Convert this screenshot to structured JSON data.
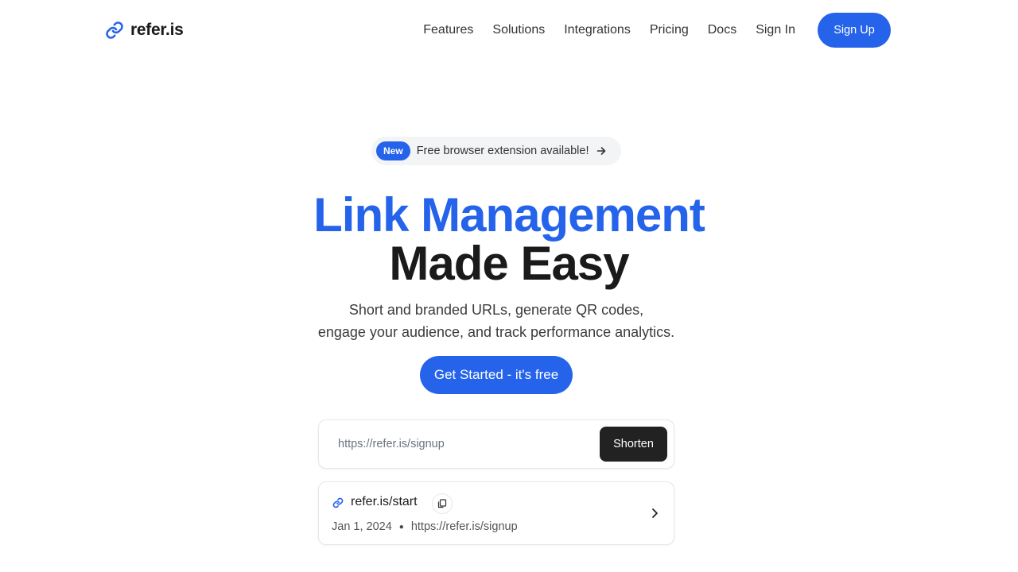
{
  "brand": {
    "name": "refer.is",
    "accent": "#2563eb"
  },
  "nav": {
    "items": [
      "Features",
      "Solutions",
      "Integrations",
      "Pricing",
      "Docs",
      "Sign In"
    ],
    "signup_label": "Sign Up"
  },
  "announcement": {
    "badge": "New",
    "text": "Free browser extension available!"
  },
  "hero": {
    "title_line1": "Link Management",
    "title_line2": "Made Easy",
    "subtitle_line1": "Short and branded URLs, generate QR codes,",
    "subtitle_line2": "engage your audience, and track performance analytics.",
    "cta_label": "Get Started - it's free"
  },
  "shortener": {
    "placeholder": "https://refer.is/signup",
    "button_label": "Shorten"
  },
  "link_card": {
    "short_url": "refer.is/start",
    "date": "Jan 1, 2024",
    "original_url": "https://refer.is/signup"
  },
  "icons": [
    "link-icon",
    "arrow-right-icon",
    "copy-icon",
    "chevron-right-icon"
  ]
}
